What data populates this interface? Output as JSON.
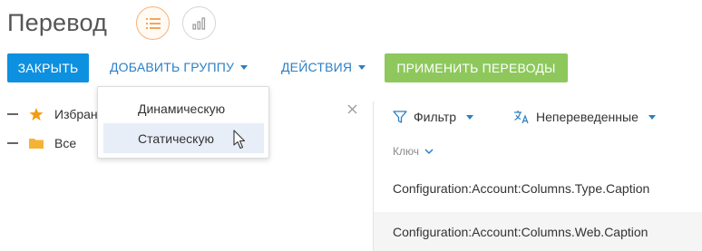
{
  "header": {
    "title": "Перевод"
  },
  "toolbar": {
    "close_label": "ЗАКРЫТЬ",
    "add_group_label": "ДОБАВИТЬ ГРУППУ",
    "actions_label": "ДЕЙСТВИЯ",
    "apply_label": "ПРИМЕНИТЬ ПЕРЕВОДЫ"
  },
  "add_group_menu": {
    "items": [
      {
        "label": "Динамическую"
      },
      {
        "label": "Статическую"
      }
    ]
  },
  "tree": {
    "items": [
      {
        "label": "Избранное",
        "icon": "star-icon"
      },
      {
        "label": "Все",
        "icon": "folder-icon"
      }
    ]
  },
  "filters": {
    "filter_label": "Фильтр",
    "untranslated_label": "Непереведенные"
  },
  "grid": {
    "key_column_label": "Ключ",
    "rows": [
      {
        "key": "Configuration:Account:Columns.Type.Caption"
      },
      {
        "key": "Configuration:Account:Columns.Web.Caption"
      }
    ]
  },
  "colors": {
    "primary": "#0d90e0",
    "apply": "#8ec85c",
    "link": "#2b7fc6",
    "star": "#f39c12",
    "folder": "#f5b335"
  }
}
